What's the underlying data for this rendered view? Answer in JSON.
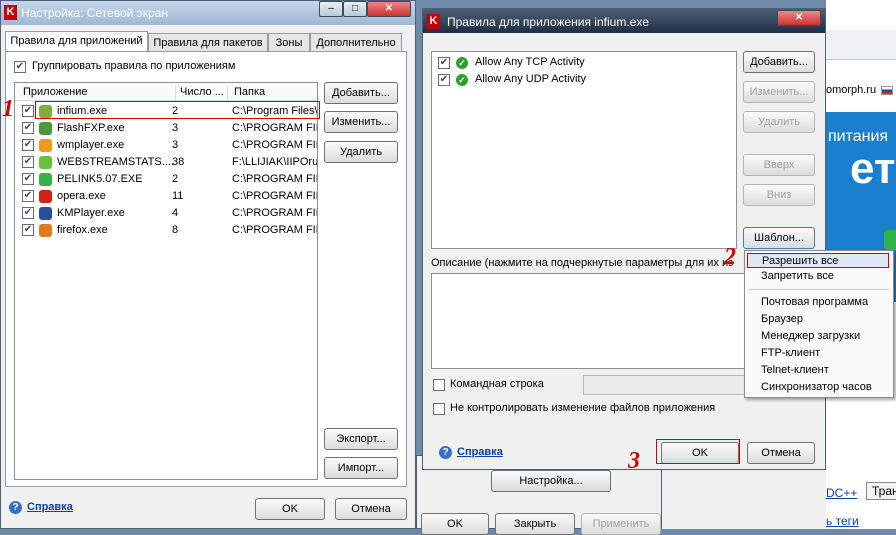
{
  "bg_browser": {
    "text_domain": "omorph.ru",
    "ad_text1": "питания",
    "ad_text2": "ет",
    "link_dc": "DC++",
    "link_translit": "Транслит",
    "link_tegi": "ь теги"
  },
  "bg_dialog": {
    "settings_button": "Настройка...",
    "ok": "OK",
    "close": "Закрыть",
    "apply": "Применить"
  },
  "firewall_window": {
    "title": "Настройка: Сетевой экран",
    "tabs": [
      "Правила для приложений",
      "Правила для пакетов",
      "Зоны",
      "Дополнительно"
    ],
    "group_checkbox": "Группировать правила по приложениям",
    "columns": [
      "Приложение",
      "Число ...",
      "Папка"
    ],
    "apps": [
      {
        "name": "infium.exe",
        "count": "2",
        "folder": "C:\\Program Files\\I",
        "icon": "infium-icon"
      },
      {
        "name": "FlashFXP.exe",
        "count": "3",
        "folder": "C:\\PROGRAM FILE",
        "icon": "flashfxp-icon"
      },
      {
        "name": "wmplayer.exe",
        "count": "3",
        "folder": "C:\\PROGRAM FILE",
        "icon": "wmplayer-icon"
      },
      {
        "name": "WEBSTREAMSTATS....",
        "count": "38",
        "folder": "F:\\LLIJIAK\\IIPOru\\",
        "icon": "webstream-icon"
      },
      {
        "name": "PELINK5.07.EXE",
        "count": "2",
        "folder": "C:\\PROGRAM FILE",
        "icon": "pelink-icon"
      },
      {
        "name": "opera.exe",
        "count": "11",
        "folder": "C:\\PROGRAM FILE",
        "icon": "opera-icon"
      },
      {
        "name": "KMPlayer.exe",
        "count": "4",
        "folder": "C:\\PROGRAM FILE",
        "icon": "kmplayer-icon"
      },
      {
        "name": "firefox.exe",
        "count": "8",
        "folder": "C:\\PROGRAM FILE",
        "icon": "firefox-icon"
      }
    ],
    "buttons": {
      "add": "Добавить...",
      "edit": "Изменить...",
      "delete": "Удалить",
      "export": "Экспорт...",
      "import": "Импорт..."
    },
    "help": "Справка",
    "ok": "OK",
    "cancel": "Отмена"
  },
  "rules_window": {
    "title": "Правила для приложения infium.exe",
    "rules": [
      "Allow Any TCP Activity",
      "Allow Any UDP Activity"
    ],
    "buttons": {
      "add": "Добавить...",
      "edit": "Изменить...",
      "delete": "Удалить",
      "up": "Вверх",
      "down": "Вниз",
      "template": "Шаблон..."
    },
    "description_label": "Описание (нажмите на подчеркнутые параметры для их из",
    "cmdline_label": "Командная строка",
    "no_control_label": "Не контролировать изменение файлов приложения",
    "help": "Справка",
    "ok": "OK",
    "cancel": "Отмена"
  },
  "template_menu": {
    "items_top": [
      "Разрешить все",
      "Запретить все"
    ],
    "items_bottom": [
      "Почтовая программа",
      "Браузер",
      "Менеджер загрузки",
      "FTP-клиент",
      "Telnet-клиент",
      "Синхронизатор часов"
    ]
  },
  "annotations": {
    "n1": "1",
    "n2": "2",
    "n3": "3"
  },
  "colors": {
    "highlight_red": "#d40000",
    "link_blue": "#0b3ea8",
    "check_green": "#2f9e2f"
  }
}
